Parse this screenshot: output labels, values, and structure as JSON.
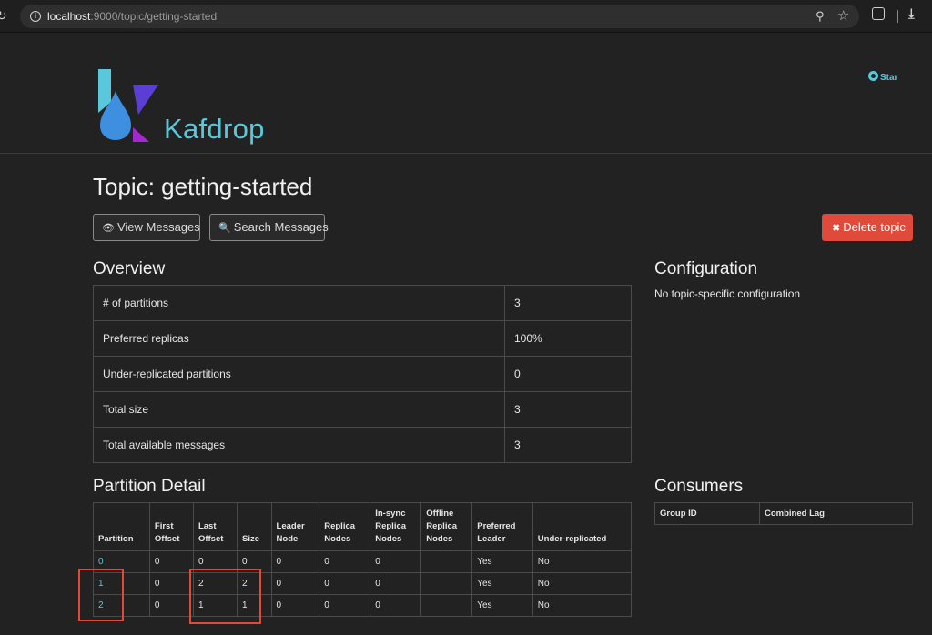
{
  "browser": {
    "url_host": "localhost",
    "url_path": ":9000/topic/getting-started"
  },
  "header": {
    "brand": "Kafdrop",
    "star_label": "Star"
  },
  "page": {
    "title": "Topic: getting-started",
    "view_messages_label": "View Messages",
    "search_messages_label": "Search Messages",
    "delete_topic_label": "Delete topic"
  },
  "overview": {
    "heading": "Overview",
    "rows": [
      {
        "label": "# of partitions",
        "value": "3"
      },
      {
        "label": "Preferred replicas",
        "value": "100%"
      },
      {
        "label": "Under-replicated partitions",
        "value": "0"
      },
      {
        "label": "Total size",
        "value": "3"
      },
      {
        "label": "Total available messages",
        "value": "3"
      }
    ]
  },
  "configuration": {
    "heading": "Configuration",
    "text": "No topic-specific configuration"
  },
  "partition_detail": {
    "heading": "Partition Detail",
    "columns": [
      [
        "Partition"
      ],
      [
        "First",
        "Offset"
      ],
      [
        "Last",
        "Offset"
      ],
      [
        "Size"
      ],
      [
        "Leader",
        "Node"
      ],
      [
        "Replica",
        "Nodes"
      ],
      [
        "In-sync",
        "Replica",
        "Nodes"
      ],
      [
        "Offline",
        "Replica",
        "Nodes"
      ],
      [
        "Preferred",
        "Leader"
      ],
      [
        "Under-replicated"
      ]
    ],
    "rows": [
      [
        "0",
        "0",
        "0",
        "0",
        "0",
        "0",
        "0",
        "",
        "Yes",
        "No"
      ],
      [
        "1",
        "0",
        "2",
        "2",
        "0",
        "0",
        "0",
        "",
        "Yes",
        "No"
      ],
      [
        "2",
        "0",
        "1",
        "1",
        "0",
        "0",
        "0",
        "",
        "Yes",
        "No"
      ]
    ]
  },
  "consumers": {
    "heading": "Consumers",
    "columns": [
      "Group ID",
      "Combined Lag"
    ]
  },
  "colors": {
    "accent": "#5ac8dc",
    "danger": "#e04a3b",
    "background": "#222222"
  },
  "icons": {
    "view": "eye-icon",
    "search": "search-icon",
    "delete": "times-icon",
    "github": "github-icon"
  }
}
